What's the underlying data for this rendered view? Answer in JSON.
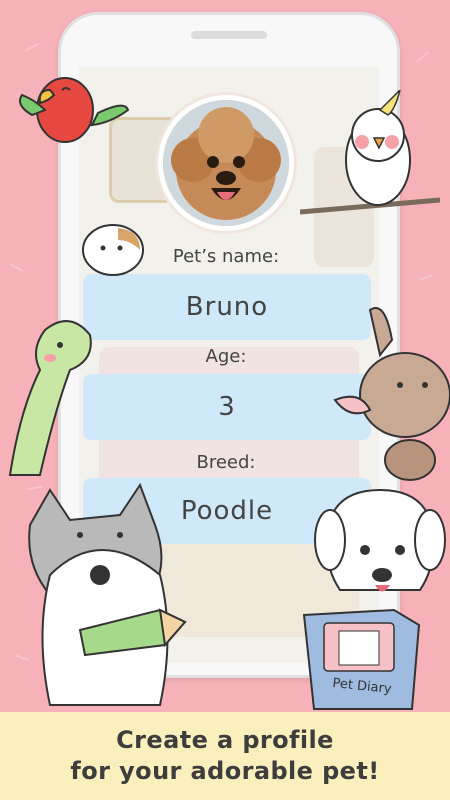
{
  "profile": {
    "name_label": "Pet’s name:",
    "name_value": "Bruno",
    "age_label": "Age:",
    "age_value": "3",
    "breed_label": "Breed:",
    "breed_value": "Poodle"
  },
  "decor": {
    "diary_title": "Pet Diary"
  },
  "caption": {
    "line1": "Create a profile",
    "line2": "for your adorable pet!"
  },
  "colors": {
    "background": "#f6b2b8",
    "field": "#cfe9fb",
    "caption_bg": "#fbf0bd"
  },
  "icons": [
    "bone-icon",
    "parrot-icon",
    "cockatiel-icon",
    "hamster-icon",
    "dinosaur-icon",
    "rabbit-icon",
    "cat-icon",
    "dog-icon",
    "pencil-icon",
    "pet-diary-book-icon"
  ]
}
